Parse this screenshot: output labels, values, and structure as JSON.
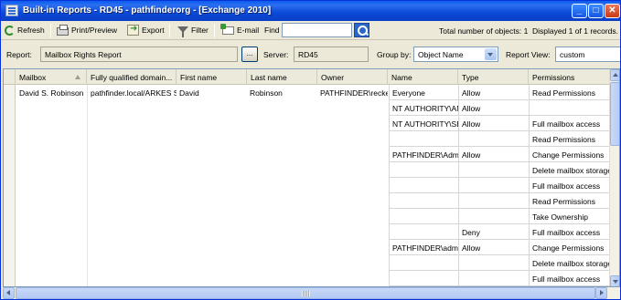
{
  "window": {
    "title": "Built-in Reports - RD45 - pathfinderorg - [Exchange 2010]",
    "minimize": "_",
    "maximize": "□",
    "close": "✕"
  },
  "toolbar": {
    "refresh": "Refresh",
    "print_preview": "Print/Preview",
    "export": "Export",
    "filter": "Filter",
    "email": "E-mail",
    "find_label": "Find",
    "find_value": "",
    "total_objects": "Total number of objects: 1",
    "displayed": "Displayed 1 of 1 records."
  },
  "report_bar": {
    "report_label": "Report:",
    "report_value": "Mailbox Rights Report",
    "browse_button": "...",
    "server_label": "Server:",
    "server_value": "RD45",
    "group_by_label": "Group by:",
    "group_by_value": "Object Name",
    "report_view_label": "Report View:",
    "report_view_value": "custom"
  },
  "grid": {
    "columns": [
      "Mailbox",
      "Fully qualified domain...",
      "First name",
      "Last name",
      "Owner",
      "Name",
      "Type",
      "Permissions"
    ],
    "main_row": {
      "mailbox": "David S. Robinson",
      "fqdn": "pathfinder.local/ARKES S",
      "first_name": "David",
      "last_name": "Robinson",
      "owner": "PATHFINDER\\recker"
    },
    "rows": [
      {
        "name": "Everyone",
        "type": "Allow",
        "permission": "Read Permissions"
      },
      {
        "name": "NT AUTHORITY\\ANONY",
        "type": "Allow",
        "permission": ""
      },
      {
        "name": "NT AUTHORITY\\SELF",
        "type": "Allow",
        "permission": "Full mailbox access"
      },
      {
        "name": "",
        "type": "",
        "permission": "Read Permissions"
      },
      {
        "name": "PATHFINDER\\Administrator",
        "type": "Allow",
        "permission": "Change Permissions"
      },
      {
        "name": "",
        "type": "",
        "permission": "Delete mailbox storage"
      },
      {
        "name": "",
        "type": "",
        "permission": "Full mailbox access"
      },
      {
        "name": "",
        "type": "",
        "permission": "Read Permissions"
      },
      {
        "name": "",
        "type": "",
        "permission": "Take Ownership"
      },
      {
        "name": "",
        "type": "Deny",
        "permission": "Full mailbox access"
      },
      {
        "name": "PATHFINDER\\administrator",
        "type": "Allow",
        "permission": "Change Permissions"
      },
      {
        "name": "",
        "type": "",
        "permission": "Delete mailbox storage"
      },
      {
        "name": "",
        "type": "",
        "permission": "Full mailbox access"
      }
    ]
  }
}
